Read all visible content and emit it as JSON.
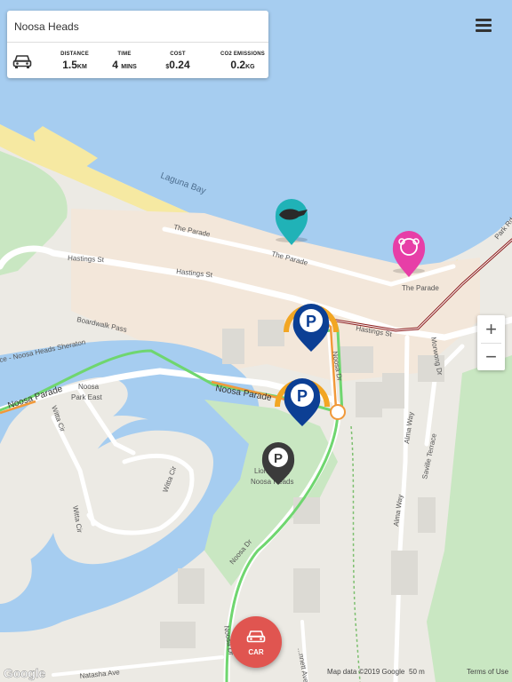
{
  "search": {
    "value": "Noosa Heads"
  },
  "stats": {
    "distance": {
      "label": "DISTANCE",
      "value": "1.5",
      "unit": "KM"
    },
    "time": {
      "label": "TIME",
      "value": "4",
      "unit": "MINS"
    },
    "cost": {
      "label": "COST",
      "prefix": "$",
      "value": "0.24"
    },
    "emissions": {
      "label": "CO2 EMISSIONS",
      "value": "0.2",
      "unit": "KG"
    }
  },
  "map_labels": {
    "laguna_bay": "Laguna Bay",
    "the_parade_1": "The Parade",
    "the_parade_2": "The Parade",
    "the_parade_3": "The Parade",
    "hastings_st_1": "Hastings St",
    "hastings_st_2": "Hastings St",
    "hastings_st_3": "Hastings St",
    "boardwalk_pass": "Boardwalk Pass",
    "sheraton": "ce - Noosa Heads Sheraton",
    "noosa_parade_1": "Noosa Parade",
    "noosa_parade_2": "Noosa Parade",
    "noosa_park_east": [
      "Noosa",
      "Park East"
    ],
    "witta_cir_1": "Witta Cir",
    "witta_cir_2": "Witta Cir",
    "witta_cir_3": "Witta Cir",
    "noosa_dr_1": "Noosa Dr",
    "noosa_dr_2": "Noosa Dr",
    "noosa_dr_3": "Noosa Dr",
    "lions_park": [
      "Lions Park,",
      "Noosa Heads"
    ],
    "alma_way_1": "Alma Way",
    "alma_way_2": "Alma Way",
    "saville_terrace": "Saville Terrace",
    "morwong_dr": "Morwong Dr",
    "park_rd": "Park Rd",
    "natasha_ave": "Natasha Ave",
    "bennett_ave": "...nnett Ave"
  },
  "zoom": {
    "in": "+",
    "out": "−"
  },
  "fab": {
    "label": "CAR"
  },
  "footer": {
    "attribution": "Map data ©2019 Google",
    "terms": "Terms of Use",
    "scale": "50 m"
  },
  "logo": "Google",
  "colors": {
    "water": "#a6cdf0",
    "land": "#eceae4",
    "sand": "#f6e9a2",
    "park": "#c9e7c2",
    "route_green": "#6fd66f",
    "parking_blue": "#0c3f94",
    "parking_orange": "#f2a623",
    "parking_grey": "#3b3b3b",
    "pin_teal": "#20b2b7",
    "pin_pink": "#e73ea7",
    "car_fab": "#e05550"
  },
  "icons": {
    "car": "car-icon",
    "menu": "hamburger-menu-icon",
    "parking": "parking-p-icon",
    "platypus": "platypus-icon",
    "koala": "koala-icon"
  }
}
